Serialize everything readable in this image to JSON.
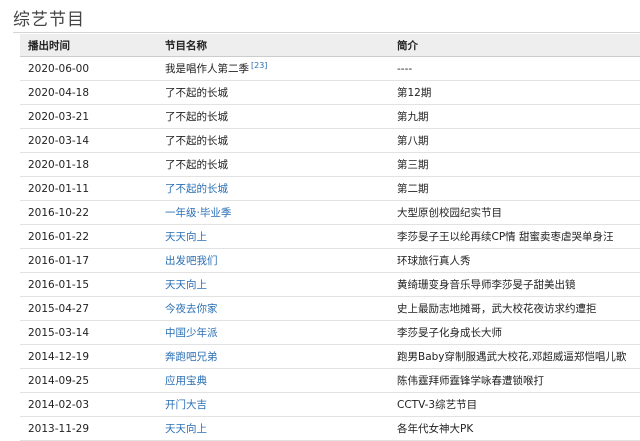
{
  "section": {
    "title": "综艺节目"
  },
  "table": {
    "headers": {
      "date": "播出时间",
      "name": "节目名称",
      "desc": "简介"
    },
    "rows": [
      {
        "date": "2020-06-00",
        "name": "我是唱作人第二季",
        "ref": "[23]",
        "linked": false,
        "desc": "----"
      },
      {
        "date": "2020-04-18",
        "name": "了不起的长城",
        "ref": "",
        "linked": false,
        "desc": "第12期"
      },
      {
        "date": "2020-03-21",
        "name": "了不起的长城",
        "ref": "",
        "linked": false,
        "desc": "第九期"
      },
      {
        "date": "2020-03-14",
        "name": "了不起的长城",
        "ref": "",
        "linked": false,
        "desc": "第八期"
      },
      {
        "date": "2020-01-18",
        "name": "了不起的长城",
        "ref": "",
        "linked": false,
        "desc": "第三期"
      },
      {
        "date": "2020-01-11",
        "name": "了不起的长城",
        "ref": "",
        "linked": true,
        "desc": "第二期"
      },
      {
        "date": "2016-10-22",
        "name": "一年级·毕业季",
        "ref": "",
        "linked": true,
        "desc": "大型原创校园纪实节目"
      },
      {
        "date": "2016-01-22",
        "name": "天天向上",
        "ref": "",
        "linked": true,
        "desc": "李莎旻子王以纶再续CP情 甜蜜卖枣虐哭单身汪"
      },
      {
        "date": "2016-01-17",
        "name": "出发吧我们",
        "ref": "",
        "linked": true,
        "desc": "环球旅行真人秀"
      },
      {
        "date": "2016-01-15",
        "name": "天天向上",
        "ref": "",
        "linked": true,
        "desc": "黄绮珊变身音乐导师李莎旻子甜美出镜"
      },
      {
        "date": "2015-04-27",
        "name": "今夜去你家",
        "ref": "",
        "linked": true,
        "desc": "史上最励志地摊哥，武大校花夜访求约遭拒"
      },
      {
        "date": "2015-03-14",
        "name": "中国少年派",
        "ref": "",
        "linked": true,
        "desc": "李莎旻子化身成长大师"
      },
      {
        "date": "2014-12-19",
        "name": "奔跑吧兄弟",
        "ref": "",
        "linked": true,
        "desc": "跑男Baby穿制服遇武大校花,邓超威逼郑恺唱儿歌"
      },
      {
        "date": "2014-09-25",
        "name": "应用宝典",
        "ref": "",
        "linked": true,
        "desc": "陈伟霆拜师霆锋学咏春遭锁喉打"
      },
      {
        "date": "2014-02-03",
        "name": "开门大吉",
        "ref": "",
        "linked": true,
        "desc": "CCTV-3综艺节目"
      },
      {
        "date": "2013-11-29",
        "name": "天天向上",
        "ref": "",
        "linked": true,
        "desc": "各年代女神大PK"
      }
    ]
  },
  "colors": {
    "link": "#2a6fb5",
    "header_bg": "#eeeeee",
    "rule": "#d5d5d5"
  }
}
